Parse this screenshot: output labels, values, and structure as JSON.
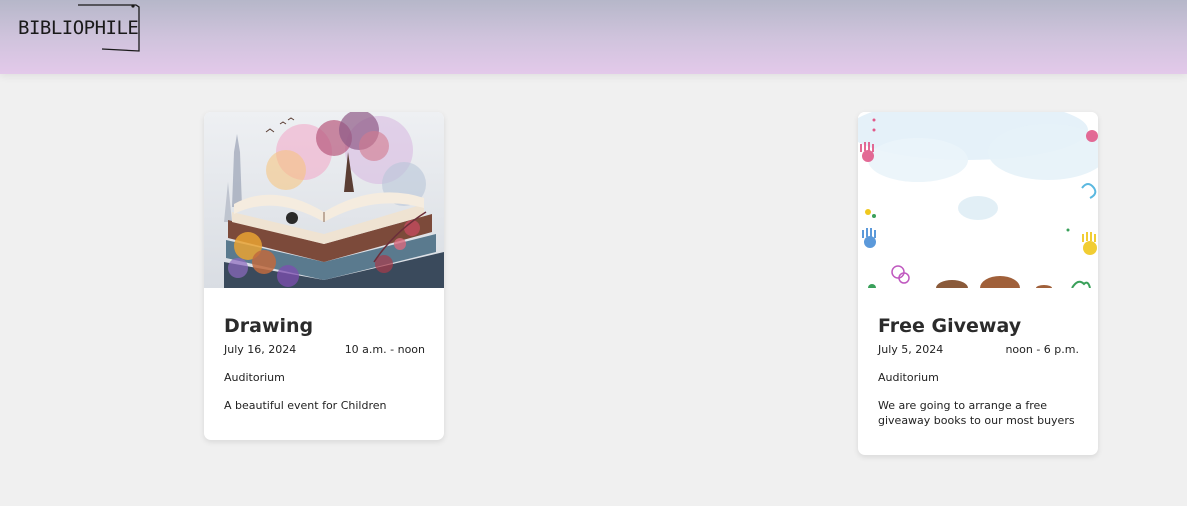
{
  "header": {
    "logo_text": "BIBLIOPHILE"
  },
  "events": [
    {
      "title": "Drawing",
      "date": "July 16, 2024",
      "time": "10 a.m. - noon",
      "venue": "Auditorium",
      "description": "A beautiful event for Children",
      "image": "watercolor-books-illustration"
    },
    {
      "title": "Free Giveway",
      "date": "July 5, 2024",
      "time": "noon - 6 p.m.",
      "venue": "Auditorium",
      "description": "We are going to arrange a free giveaway books to our most buyers",
      "image": "children-handprints-illustration"
    }
  ],
  "colors": {
    "header_top": "#b6b7c9",
    "header_bottom": "#e3c9ea",
    "page_background": "#f0f0f0",
    "card_background": "#ffffff"
  }
}
